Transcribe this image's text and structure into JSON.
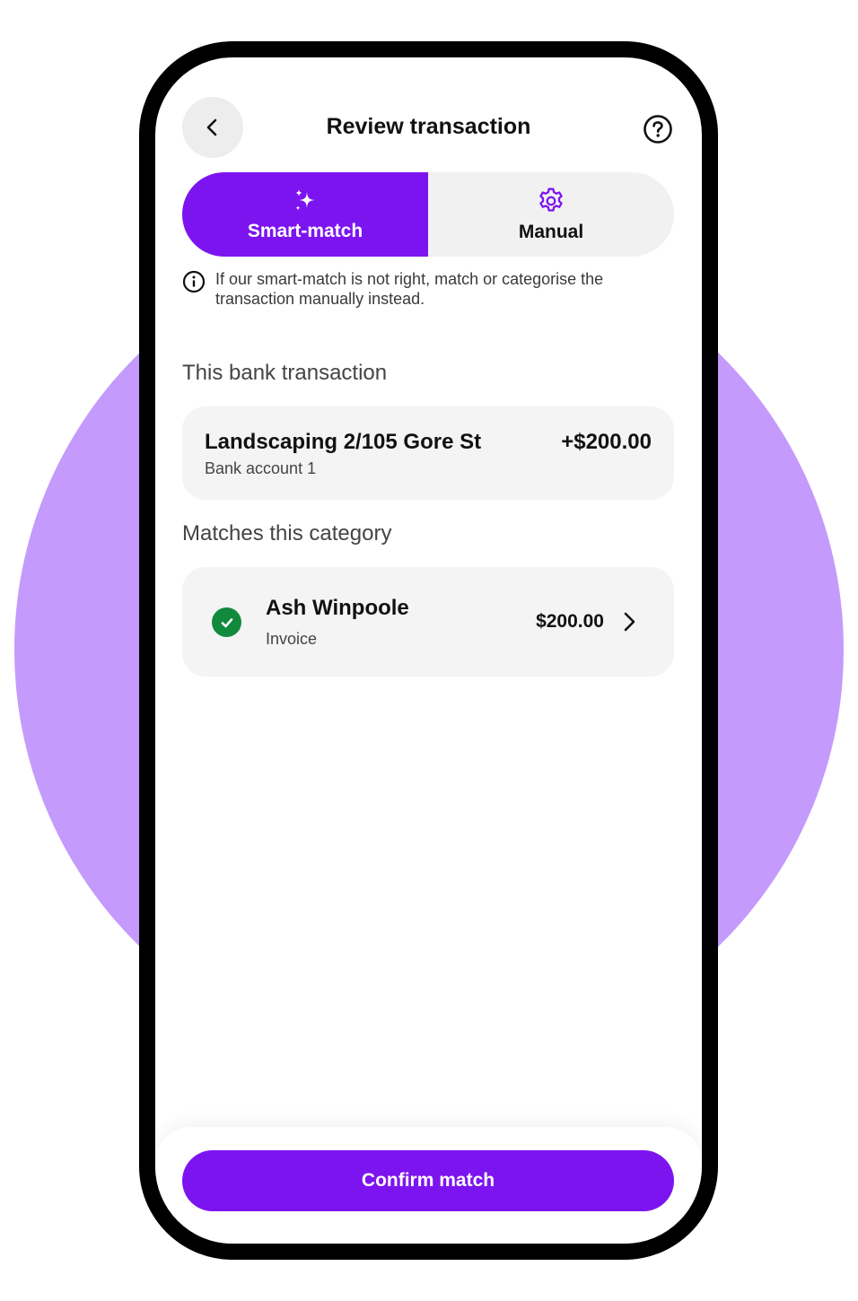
{
  "colors": {
    "accent": "#7c14f0",
    "background_circle": "#c49afc",
    "success": "#118a3e",
    "card": "#f4f4f4"
  },
  "header": {
    "back_icon": "chevron-left-icon",
    "title": "Review transaction",
    "help_icon": "question-circle-icon"
  },
  "mode_toggle": {
    "selected": "smart-match",
    "options": [
      {
        "id": "smart-match",
        "label": "Smart-match",
        "icon": "sparkles-icon"
      },
      {
        "id": "manual",
        "label": "Manual",
        "icon": "gear-icon"
      }
    ]
  },
  "info_note": {
    "icon": "info-icon",
    "text": "If our smart-match is not right, match or categorise the transaction manually instead."
  },
  "bank_transaction": {
    "section_label": "This bank transaction",
    "title": "Landscaping 2/105 Gore St",
    "account": "Bank account 1",
    "amount": "+$200.00"
  },
  "match": {
    "section_label": "Matches this category",
    "status_icon": "check-circle-icon",
    "name": "Ash Winpoole",
    "type": "Invoice",
    "amount": "$200.00",
    "chevron_icon": "chevron-right-icon"
  },
  "footer": {
    "confirm_label": "Confirm match"
  }
}
